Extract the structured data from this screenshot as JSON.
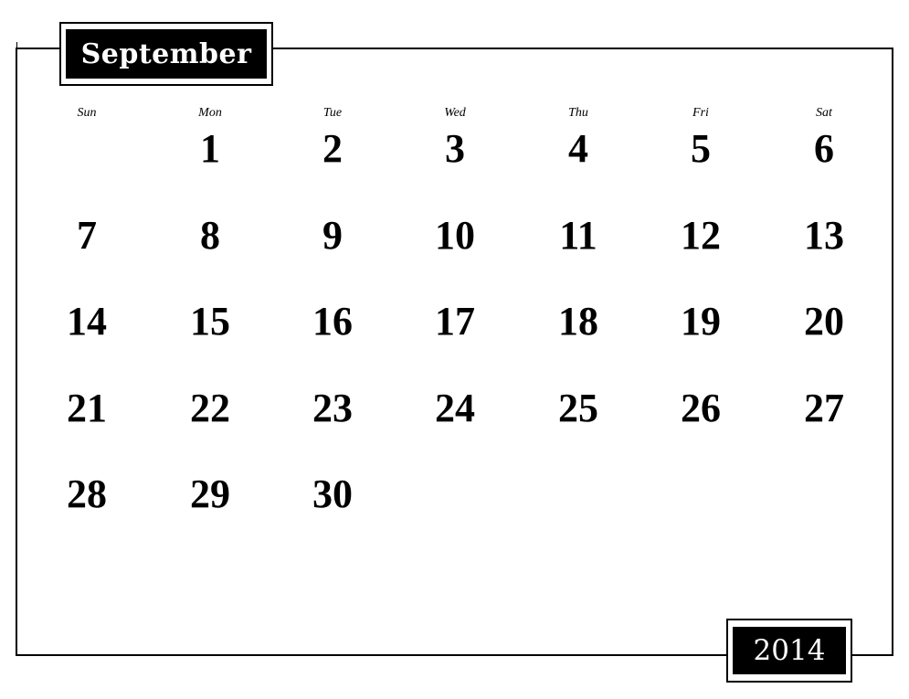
{
  "calendar": {
    "month": "September",
    "year": "2014",
    "weekdays": [
      "Sun",
      "Mon",
      "Tue",
      "Wed",
      "Thu",
      "Fri",
      "Sat"
    ],
    "first_weekday_index": 1,
    "days_in_month": 30,
    "weeks": [
      [
        "",
        "1",
        "2",
        "3",
        "4",
        "5",
        "6"
      ],
      [
        "7",
        "8",
        "9",
        "10",
        "11",
        "12",
        "13"
      ],
      [
        "14",
        "15",
        "16",
        "17",
        "18",
        "19",
        "20"
      ],
      [
        "21",
        "22",
        "23",
        "24",
        "25",
        "26",
        "27"
      ],
      [
        "28",
        "29",
        "30",
        "",
        "",
        "",
        ""
      ]
    ]
  },
  "colors": {
    "ink": "#000000",
    "paper": "#ffffff"
  }
}
